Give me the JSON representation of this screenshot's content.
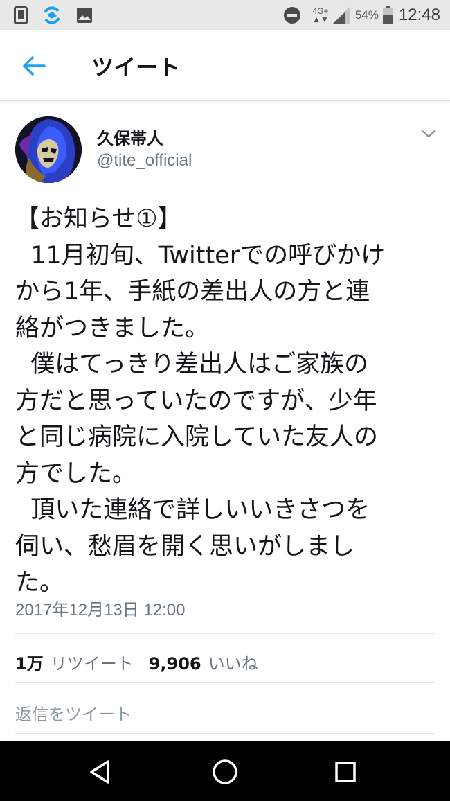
{
  "status_bar": {
    "network_type": "4G+",
    "battery_percent": "54%",
    "time": "12:48",
    "icons": [
      "phone-frame-icon",
      "sync-app-icon",
      "gallery-icon",
      "do-not-disturb-icon",
      "signal-icon",
      "battery-icon"
    ]
  },
  "header": {
    "title": "ツイート",
    "back_icon": "back-arrow-icon"
  },
  "tweet": {
    "author_name": "久保帯人",
    "author_handle": "@tite_official",
    "menu_icon": "chevron-down-icon",
    "body_lines": [
      "【お知らせ①】",
      "  11月初旬、Twitterでの呼びかけ",
      "から1年、手紙の差出人の方と連",
      "絡がつきました。",
      "  僕はてっきり差出人はご家族の",
      "方だと思っていたのですが、少年",
      "と同じ病院に入院していた友人の",
      "方でした。",
      "  頂いた連絡で詳しいいきさつを",
      "伺い、愁眉を開く思いがしまし",
      "た。"
    ],
    "timestamp": "2017年12月13日 12:00",
    "retweet_count": "1万",
    "retweet_label": "リツイート",
    "like_count": "9,906",
    "like_label": "いいね"
  },
  "reply": {
    "placeholder": "返信をツイート"
  },
  "colors": {
    "accent": "#1da1f2",
    "secondary_text": "#657786",
    "primary_text": "#14171a",
    "divider": "#e1e8ed"
  },
  "nav_bar": {
    "buttons": [
      "nav-back-icon",
      "nav-home-icon",
      "nav-recents-icon"
    ]
  }
}
